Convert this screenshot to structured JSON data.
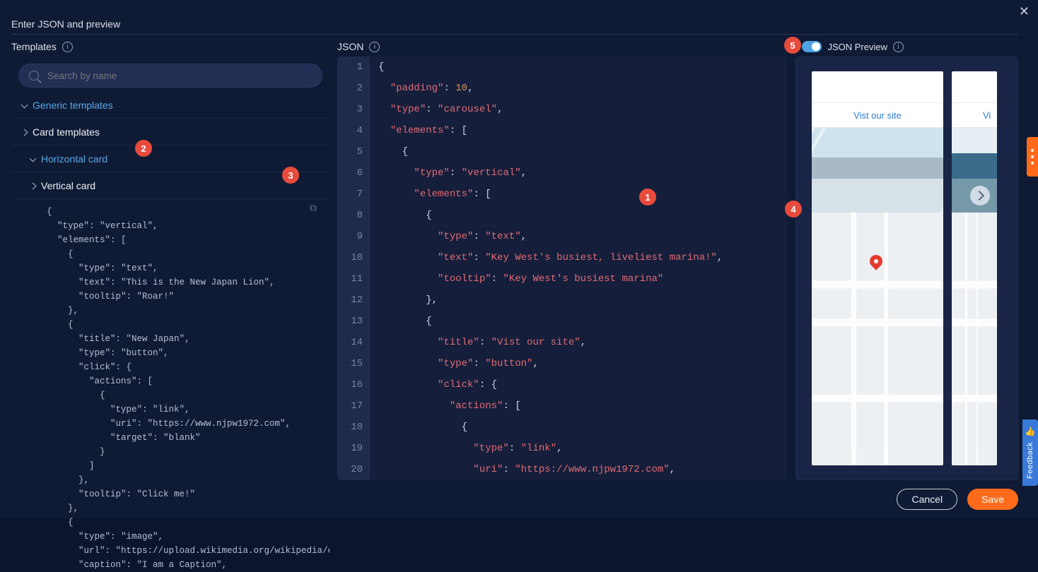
{
  "dialog": {
    "title": "Enter JSON and preview"
  },
  "sections": {
    "templates_label": "Templates",
    "json_label": "JSON",
    "preview_toggle_label": "JSON Preview"
  },
  "search": {
    "placeholder": "Search by name"
  },
  "tree": {
    "generic": "Generic templates",
    "card_templates": "Card templates",
    "horizontal_card": "Horizontal card",
    "vertical_card": "Vertical card"
  },
  "template_code": "{\n  \"type\": \"vertical\",\n  \"elements\": [\n    {\n      \"type\": \"text\",\n      \"text\": \"This is the New Japan Lion\",\n      \"tooltip\": \"Roar!\"\n    },\n    {\n      \"title\": \"New Japan\",\n      \"type\": \"button\",\n      \"click\": {\n        \"actions\": [\n          {\n            \"type\": \"link\",\n            \"uri\": \"https://www.njpw1972.com\",\n            \"target\": \"blank\"\n          }\n        ]\n      },\n      \"tooltip\": \"Click me!\"\n    },\n    {\n      \"type\": \"image\",\n      \"url\": \"https://upload.wikimedia.org/wikipedia/en/th\n      \"caption\": \"I am a Caption\",",
  "editor": {
    "lines": [
      {
        "n": 1,
        "i": 0,
        "t": [
          [
            "p",
            "{"
          ]
        ]
      },
      {
        "n": 2,
        "i": 1,
        "t": [
          [
            "k",
            "\"padding\""
          ],
          [
            "p",
            ": "
          ],
          [
            "n",
            "10"
          ],
          [
            "p",
            ","
          ]
        ]
      },
      {
        "n": 3,
        "i": 1,
        "t": [
          [
            "k",
            "\"type\""
          ],
          [
            "p",
            ": "
          ],
          [
            "s",
            "\"carousel\""
          ],
          [
            "p",
            ","
          ]
        ]
      },
      {
        "n": 4,
        "i": 1,
        "t": [
          [
            "k",
            "\"elements\""
          ],
          [
            "p",
            ": ["
          ]
        ]
      },
      {
        "n": 5,
        "i": 2,
        "t": [
          [
            "p",
            "{"
          ]
        ]
      },
      {
        "n": 6,
        "i": 3,
        "t": [
          [
            "k",
            "\"type\""
          ],
          [
            "p",
            ": "
          ],
          [
            "s",
            "\"vertical\""
          ],
          [
            "p",
            ","
          ]
        ]
      },
      {
        "n": 7,
        "i": 3,
        "t": [
          [
            "k",
            "\"elements\""
          ],
          [
            "p",
            ": ["
          ]
        ]
      },
      {
        "n": 8,
        "i": 4,
        "t": [
          [
            "p",
            "{"
          ]
        ]
      },
      {
        "n": 9,
        "i": 5,
        "t": [
          [
            "k",
            "\"type\""
          ],
          [
            "p",
            ": "
          ],
          [
            "s",
            "\"text\""
          ],
          [
            "p",
            ","
          ]
        ]
      },
      {
        "n": 10,
        "i": 5,
        "t": [
          [
            "k",
            "\"text\""
          ],
          [
            "p",
            ": "
          ],
          [
            "s",
            "\"Key West's busiest, liveliest marina!\""
          ],
          [
            "p",
            ","
          ]
        ]
      },
      {
        "n": 11,
        "i": 5,
        "t": [
          [
            "k",
            "\"tooltip\""
          ],
          [
            "p",
            ": "
          ],
          [
            "s",
            "\"Key West's busiest marina\""
          ]
        ]
      },
      {
        "n": 12,
        "i": 4,
        "t": [
          [
            "p",
            "},"
          ]
        ]
      },
      {
        "n": 13,
        "i": 4,
        "t": [
          [
            "p",
            "{"
          ]
        ]
      },
      {
        "n": 14,
        "i": 5,
        "t": [
          [
            "k",
            "\"title\""
          ],
          [
            "p",
            ": "
          ],
          [
            "s",
            "\"Vist our site\""
          ],
          [
            "p",
            ","
          ]
        ]
      },
      {
        "n": 15,
        "i": 5,
        "t": [
          [
            "k",
            "\"type\""
          ],
          [
            "p",
            ": "
          ],
          [
            "s",
            "\"button\""
          ],
          [
            "p",
            ","
          ]
        ]
      },
      {
        "n": 16,
        "i": 5,
        "t": [
          [
            "k",
            "\"click\""
          ],
          [
            "p",
            ": {"
          ]
        ]
      },
      {
        "n": 17,
        "i": 6,
        "t": [
          [
            "k",
            "\"actions\""
          ],
          [
            "p",
            ": ["
          ]
        ]
      },
      {
        "n": 18,
        "i": 7,
        "t": [
          [
            "p",
            "{"
          ]
        ]
      },
      {
        "n": 19,
        "i": 8,
        "t": [
          [
            "k",
            "\"type\""
          ],
          [
            "p",
            ": "
          ],
          [
            "s",
            "\"link\""
          ],
          [
            "p",
            ","
          ]
        ]
      },
      {
        "n": 20,
        "i": 8,
        "t": [
          [
            "k",
            "\"uri\""
          ],
          [
            "p",
            ": "
          ],
          [
            "s",
            "\"https://www.njpw1972.com\""
          ],
          [
            "p",
            ","
          ]
        ]
      }
    ]
  },
  "preview": {
    "card1_link": "Vist our site",
    "card2_link": "Vi"
  },
  "badges": {
    "b1": "1",
    "b2": "2",
    "b3": "3",
    "b4": "4",
    "b5": "5"
  },
  "footer": {
    "cancel": "Cancel",
    "save": "Save"
  },
  "feedback": {
    "label": "Feedback"
  }
}
